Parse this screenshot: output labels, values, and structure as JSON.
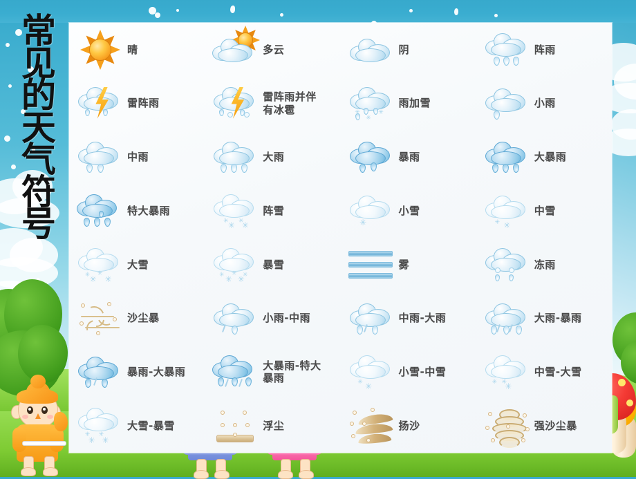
{
  "slide": {
    "title_chars": [
      "常",
      "见",
      "的",
      "天",
      "气",
      "符",
      "号"
    ],
    "title_text": "常见的天气符号",
    "accent_color": "#3aabcd",
    "panel_color": "#f6f9fb",
    "label_color": "#4a4a4a"
  },
  "symbols": [
    {
      "icon": "sun-icon",
      "label": "晴"
    },
    {
      "icon": "cloud-sun-icon",
      "label": "多云"
    },
    {
      "icon": "cloud-overcast-icon",
      "label": "阴"
    },
    {
      "icon": "cloud-shower-icon",
      "label": "阵雨"
    },
    {
      "icon": "cloud-thunder-rain-icon",
      "label": "雷阵雨"
    },
    {
      "icon": "cloud-thunder-hail-icon",
      "label": "雷阵雨并伴有冰雹"
    },
    {
      "icon": "cloud-sleet-icon",
      "label": "雨加雪"
    },
    {
      "icon": "cloud-light-rain-icon",
      "label": "小雨"
    },
    {
      "icon": "cloud-moderate-rain-icon",
      "label": "中雨"
    },
    {
      "icon": "cloud-heavy-rain-icon",
      "label": "大雨"
    },
    {
      "icon": "cloud-rainstorm-icon",
      "label": "暴雨"
    },
    {
      "icon": "cloud-big-rainstorm-icon",
      "label": "大暴雨"
    },
    {
      "icon": "cloud-severe-rainstorm-icon",
      "label": "特大暴雨"
    },
    {
      "icon": "cloud-snow-shower-icon",
      "label": "阵雪"
    },
    {
      "icon": "cloud-light-snow-icon",
      "label": "小雪"
    },
    {
      "icon": "cloud-moderate-snow-icon",
      "label": "中雪"
    },
    {
      "icon": "cloud-heavy-snow-icon",
      "label": "大雪"
    },
    {
      "icon": "cloud-snowstorm-icon",
      "label": "暴雪"
    },
    {
      "icon": "fog-icon",
      "label": "雾"
    },
    {
      "icon": "cloud-freezing-rain-icon",
      "label": "冻雨"
    },
    {
      "icon": "sandstorm-icon",
      "label": "沙尘暴"
    },
    {
      "icon": "cloud-light-to-moderate-rain-icon",
      "label": "小雨-中雨"
    },
    {
      "icon": "cloud-moderate-to-heavy-rain-icon",
      "label": "中雨-大雨"
    },
    {
      "icon": "cloud-heavy-rain-to-rainstorm-icon",
      "label": "大雨-暴雨"
    },
    {
      "icon": "cloud-rainstorm-to-big-rainstorm-icon",
      "label": "暴雨-大暴雨"
    },
    {
      "icon": "cloud-big-to-severe-rainstorm-icon",
      "label": "大暴雨-特大暴雨"
    },
    {
      "icon": "cloud-light-to-moderate-snow-icon",
      "label": "小雪-中雪"
    },
    {
      "icon": "cloud-moderate-to-heavy-snow-icon",
      "label": "中雪-大雪"
    },
    {
      "icon": "cloud-heavy-snow-to-snowstorm-icon",
      "label": "大雪-暴雪"
    },
    {
      "icon": "floating-dust-icon",
      "label": "浮尘"
    },
    {
      "icon": "blowing-sand-icon",
      "label": "扬沙"
    },
    {
      "icon": "severe-sandstorm-icon",
      "label": "强沙尘暴"
    }
  ]
}
